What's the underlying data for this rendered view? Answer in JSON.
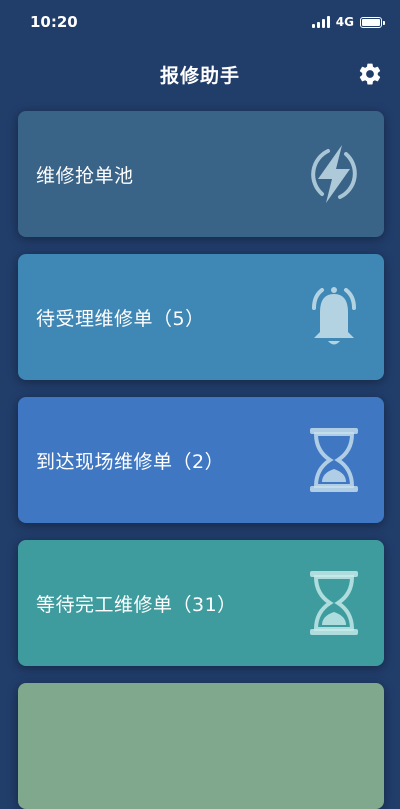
{
  "status_bar": {
    "time": "10:20",
    "network": "4G"
  },
  "header": {
    "title": "报修助手",
    "settings_icon": "gear-icon"
  },
  "cards": [
    {
      "label": "维修抢单池",
      "icon": "lightning-icon",
      "color": "#3a6388"
    },
    {
      "label": "待受理维修单（5）",
      "icon": "bell-icon",
      "color": "#3f87b5"
    },
    {
      "label": "到达现场维修单（2）",
      "icon": "hourglass-icon",
      "color": "#3f77c2"
    },
    {
      "label": "等待完工维修单（31）",
      "icon": "hourglass-icon",
      "color": "#3f9c9e"
    },
    {
      "label": "",
      "icon": "",
      "color": "#7fa88c"
    }
  ]
}
